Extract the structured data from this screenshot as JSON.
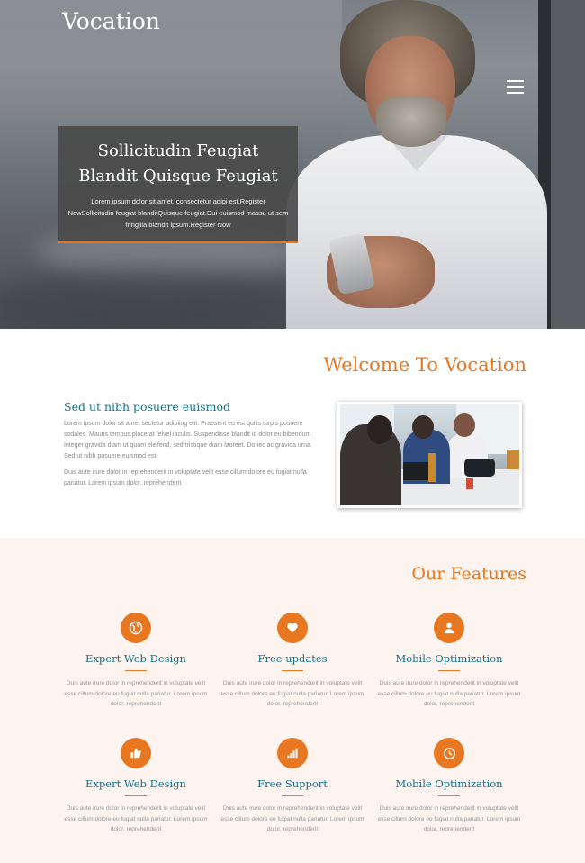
{
  "header": {
    "logo": "Vocation",
    "menu_icon": "hamburger-menu-icon"
  },
  "hero": {
    "title": "Sollicitudin Feugiat Blandit Quisque Feugiat",
    "text": "Lorem ipsum dolor sit amet, consectetur adipi est.Register NowSollicitudin feugiat blanditQuisque feugiat.Dui euismod massa ut sem fringilla blandit ipsum.Register Now",
    "accent_color": "#e87722"
  },
  "welcome": {
    "heading": "Welcome To Vocation",
    "subheading": "Sed ut nibh posuere euismod",
    "paragraph1": "Lorem ipsum dolor sit amet sectetur adipiing elit. Praesent eu est quilis turpis posuere sodales. Mauris tempus placerat felvel iaculis. Suspendisse blandit id dolor eu bibendum. Integer gravida diam ut quam eleifend, sed tristique diam laoreet. Donec ac gravida urna. Sed ut nibh posuere euismod est",
    "paragraph2": "Duis aute irure dolor in reprehenderit in voluptate velit esse cillum dolore eu fugiat nulla pariatur. Lorem ipsum dolor. reprehenderit"
  },
  "features": {
    "heading": "Our Features",
    "items": [
      {
        "title": "Expert Web Design",
        "icon": "globe-icon",
        "text": "Duis aute irure dolor in reprehenderit in voluptate velit esse cillum dolore eu fugiat nulla pariatur. Lorem ipsum dolor. reprehenderit"
      },
      {
        "title": "Free updates",
        "icon": "heart-icon",
        "text": "Duis aute irure dolor in reprehenderit in voluptate velit esse cillum dolore eu fugiat nulla pariatur. Lorem ipsum dolor. reprehenderit"
      },
      {
        "title": "Mobile Optimization",
        "icon": "user-icon",
        "text": "Duis aute irure dolor in reprehenderit in voluptate velit esse cillum dolore eu fugiat nulla pariatur. Lorem ipsum dolor. reprehenderit"
      },
      {
        "title": "Expert Web Design",
        "icon": "thumbs-up-icon",
        "text": "Duis aute irure dolor in reprehenderit in voluptate velit esse cillum dolore eu fugiat nulla pariatur. Lorem ipsum dolor. reprehenderit"
      },
      {
        "title": "Free Support",
        "icon": "bar-chart-icon",
        "text": "Duis aute irure dolor in reprehenderit in voluptate velit esse cillum dolore eu fugiat nulla pariatur. Lorem ipsum dolor. reprehenderit"
      },
      {
        "title": "Mobile Optimization",
        "icon": "clock-icon",
        "text": "Duis aute irure dolor in reprehenderit in voluptate velit esse cillum dolore eu fugiat nulla pariatur. Lorem ipsum dolor. reprehenderit"
      }
    ]
  }
}
